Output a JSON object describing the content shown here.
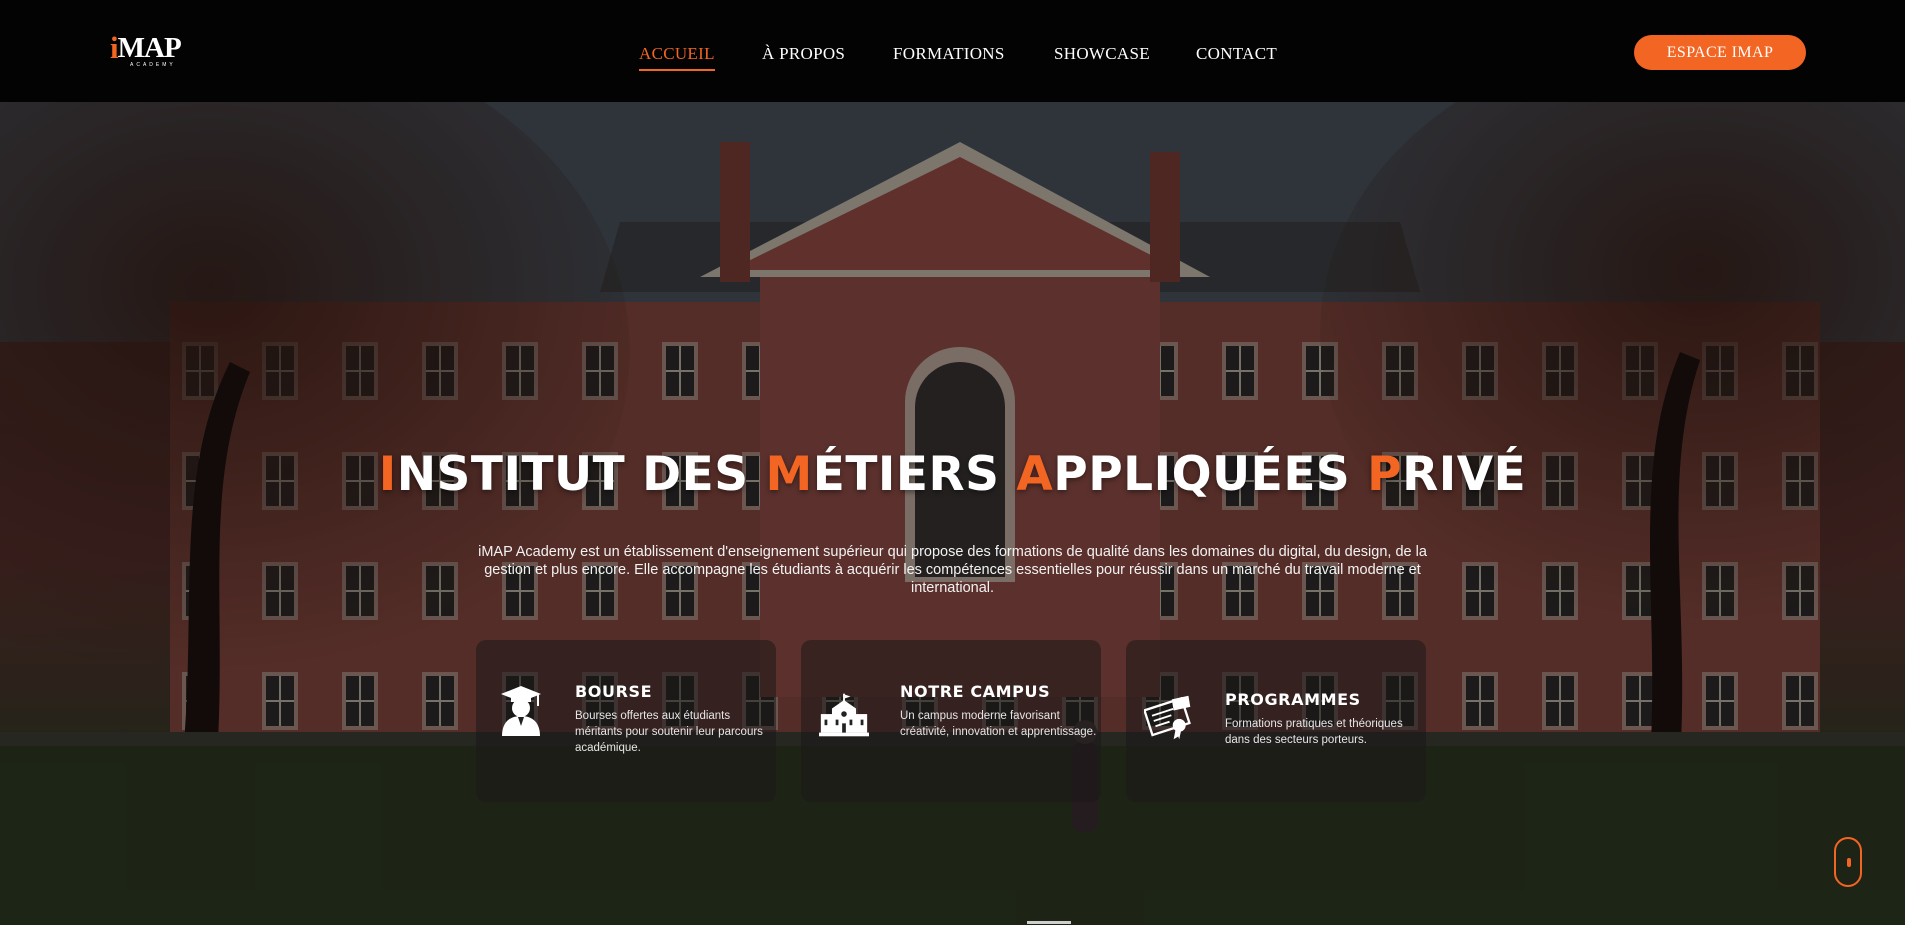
{
  "brand": {
    "logo_i": "i",
    "logo_rest": "MAP",
    "logo_sub": "ACADEMY",
    "accent_color": "#f26522"
  },
  "nav": {
    "items": [
      {
        "label": "ACCUEIL",
        "active": true
      },
      {
        "label": "À PROPOS",
        "active": false
      },
      {
        "label": "FORMATIONS",
        "active": false
      },
      {
        "label": "SHOWCASE",
        "active": false
      },
      {
        "label": "CONTACT",
        "active": false
      }
    ]
  },
  "header": {
    "cta_label": "ESPACE IMAP"
  },
  "hero": {
    "title": [
      {
        "first": "I",
        "rest": "NSTITUT DES "
      },
      {
        "first": "M",
        "rest": "ÉTIERS "
      },
      {
        "first": "A",
        "rest": "PPLIQUÉES "
      },
      {
        "first": "P",
        "rest": "RIVÉ"
      }
    ],
    "description": "iMAP Academy est un établissement d'enseignement supérieur qui propose des formations de qualité dans les domaines du digital, du design, de la gestion et plus encore. Elle accompagne les étudiants à acquérir les compétences essentielles pour réussir dans un marché du travail moderne et international."
  },
  "cards": [
    {
      "icon": "graduate-icon",
      "title": "BOURSE",
      "text": "Bourses offertes aux étudiants méritants pour soutenir leur parcours académique."
    },
    {
      "icon": "campus-building-icon",
      "title": "NOTRE CAMPUS",
      "text": "Un campus moderne favorisant créativité, innovation et apprentissage."
    },
    {
      "icon": "diploma-certificate-icon",
      "title": "PROGRAMMES",
      "text": "Formations pratiques et théoriques dans des secteurs porteurs."
    }
  ],
  "scroll_indicator": {
    "icon": "mouse-scroll-icon"
  }
}
